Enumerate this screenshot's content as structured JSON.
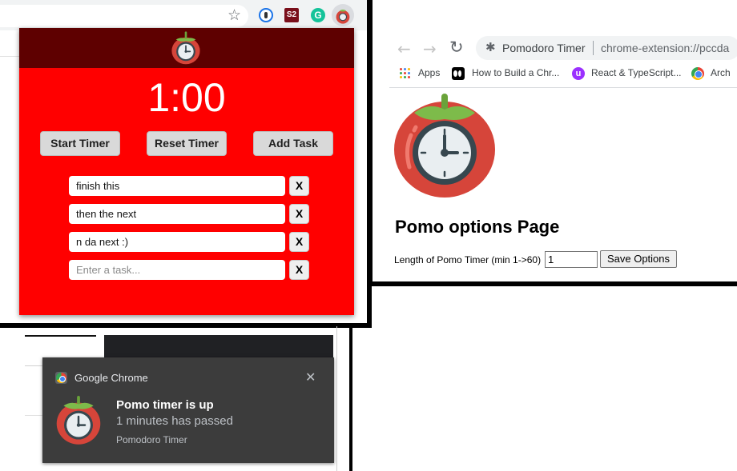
{
  "popup": {
    "timer": "1:00",
    "buttons": {
      "start": "Start Timer",
      "reset": "Reset Timer",
      "add": "Add Task"
    },
    "tasks": [
      {
        "value": "finish this",
        "remove": "X"
      },
      {
        "value": "then the next",
        "remove": "X"
      },
      {
        "value": "n da next :)",
        "remove": "X"
      }
    ],
    "new_task": {
      "placeholder": "Enter a task...",
      "remove": "X"
    },
    "colors": {
      "background": "#ff0000",
      "header": "#5e0000"
    }
  },
  "browser_toolbar": {
    "icons": [
      "star-icon",
      "password-extension-icon",
      "s2-extension-icon",
      "grammarly-extension-icon",
      "pomodoro-extension-icon"
    ],
    "s2_label": "S2",
    "grammarly_label": "G"
  },
  "options_page": {
    "nav": {
      "page_name": "Pomodoro Timer",
      "url": "chrome-extension://pccda"
    },
    "bookmarks": [
      {
        "label": "Apps"
      },
      {
        "label": "How to Build a Chr..."
      },
      {
        "label": "React & TypeScript..."
      },
      {
        "label": "Arch"
      }
    ],
    "heading": "Pomo options Page",
    "length_label": "Length of Pomo Timer (min 1->60)",
    "length_value": "1",
    "save_label": "Save Options"
  },
  "notification": {
    "app_name": "Google Chrome",
    "title": "Pomo timer is up",
    "body": "1 minutes has passed",
    "source": "Pomodoro Timer",
    "close": "✕"
  }
}
